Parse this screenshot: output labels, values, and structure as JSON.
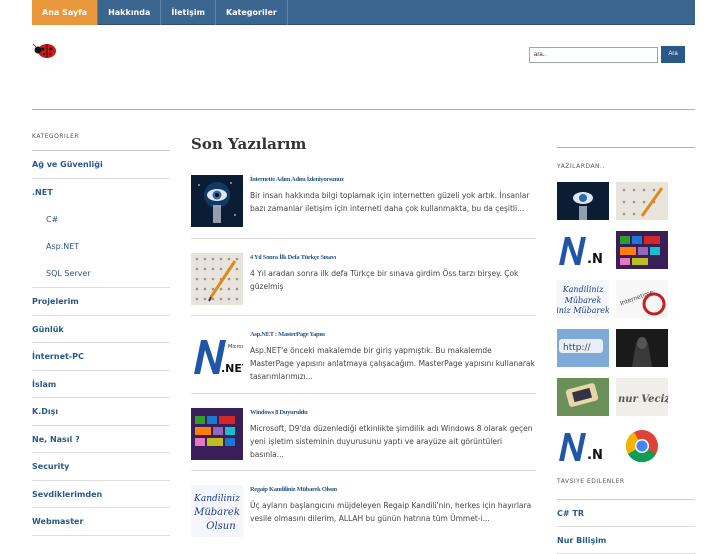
{
  "nav": {
    "items": [
      {
        "label": "Ana Sayfa",
        "active": true
      },
      {
        "label": "Hakkında",
        "active": false
      },
      {
        "label": "İletişim",
        "active": false
      },
      {
        "label": "Kategoriler",
        "active": false
      }
    ]
  },
  "header": {
    "logo_icon": "ladybug-icon",
    "search_placeholder": "ara..",
    "search_button": "Ara"
  },
  "sidebar": {
    "title": "KATEGORILER",
    "items": [
      {
        "label": "Ağ ve Güvenliği"
      },
      {
        "label": ".NET"
      },
      {
        "label": "C#",
        "sub": true
      },
      {
        "label": "Asp.NET",
        "sub": true
      },
      {
        "label": "SQL Server",
        "sub": true
      },
      {
        "label": "Projelerim"
      },
      {
        "label": "Günlük"
      },
      {
        "label": "İnternet-PC"
      },
      {
        "label": "İslam"
      },
      {
        "label": "K.Dışı"
      },
      {
        "label": "Ne, Nasıl ?"
      },
      {
        "label": "Security"
      },
      {
        "label": "Sevdiklerimden"
      },
      {
        "label": "Webmaster"
      }
    ]
  },
  "main": {
    "title": "Son Yazılarım",
    "posts": [
      {
        "title": "İnternette Adım Adım İzleniyorsunuz",
        "excerpt": "Bir insan hakkında bilgi toplamak için internetten güzeli yok artık. İnsanlar bazı zamanlar iletişim için interneti daha çok kullanmakta, bu da çeşitli...",
        "thumb": "eye-image"
      },
      {
        "title": "4 Yıl Sonra İlk Defa Türkçe Sınavı",
        "excerpt": "4 Yıl aradan sonra ilk defa Türkçe bir sınava girdim Öss tarzı birşey. Çok güzelmiş",
        "thumb": "exam-sheet-image"
      },
      {
        "title": "Asp.NET : MasterPage Yapısı",
        "excerpt": "Asp.NET'e önceki makalemde bir giriş yapmıştık. Bu makalemde MasterPage yapısını anlatmaya çalışacağım. MasterPage yapısını kullanarak tasarımlarımızı...",
        "thumb": "dotnet-logo-image"
      },
      {
        "title": "Windows 8 Duyuruldu",
        "excerpt": "Microsoft, D9'da düzenlediği etkinlikte şimdilik adı Windows 8 olarak geçen yeni işletim sisteminin duyurusunu yaptı ve arayüze ait görüntüleri basınla...",
        "thumb": "windows8-image"
      },
      {
        "title": "Regaip Kandiliniz Mübarek Olsun",
        "excerpt": "Üç ayların başlangıcını müjdeleyen Regaip Kandili'nin, herkes için hayırlara vesile olmasını dilerim, ALLAH bu günün hatrına tüm Ümmet-i...",
        "thumb": "kandil-image"
      }
    ]
  },
  "right": {
    "title": "YAZILARDAN..",
    "thumbs": [
      "eye-image",
      "exam-sheet-image",
      "dotnet-logo-image",
      "windows8-image",
      "kandil-image",
      "internetime-image",
      "http-image",
      "hacker-image",
      "phone-image",
      "nur-vecize-image",
      "dotnet-logo-image",
      "chrome-logo-image"
    ],
    "thumb_texts": {
      "dotnet": ".N",
      "kandil": "Kandiliniz Mübarek Olsun",
      "nur": "nur Veciz"
    },
    "recommended_title": "TAVSIYE EDILENLER",
    "recommended": [
      {
        "label": "C# TR"
      },
      {
        "label": "Nur Bilişim"
      }
    ]
  },
  "colors": {
    "nav": "#3c6690",
    "active": "#e8973a",
    "link": "#2a5887",
    "accent_line": "#e8a85a"
  }
}
